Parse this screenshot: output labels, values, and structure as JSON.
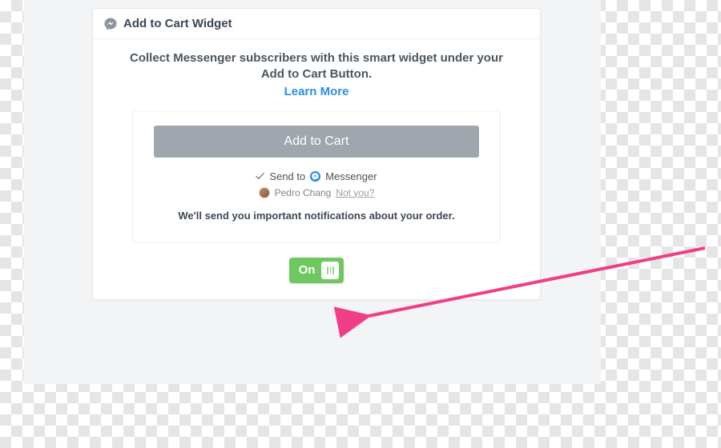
{
  "card": {
    "title": "Add to Cart Widget",
    "description": "Collect Messenger subscribers with this smart widget under your Add to Cart Button.",
    "learn_more": "Learn More"
  },
  "preview": {
    "add_to_cart": "Add to Cart",
    "send_to_prefix": "Send to",
    "messenger_label": "Messenger",
    "user_name": "Pedro Chang",
    "not_you": "Not you?",
    "notification_text": "We'll send you important notifications about your order."
  },
  "toggle": {
    "label": "On",
    "state": "on"
  },
  "colors": {
    "link": "#2b8ee6",
    "toggle": "#6fc85f",
    "arrow": "#ef3e86"
  }
}
